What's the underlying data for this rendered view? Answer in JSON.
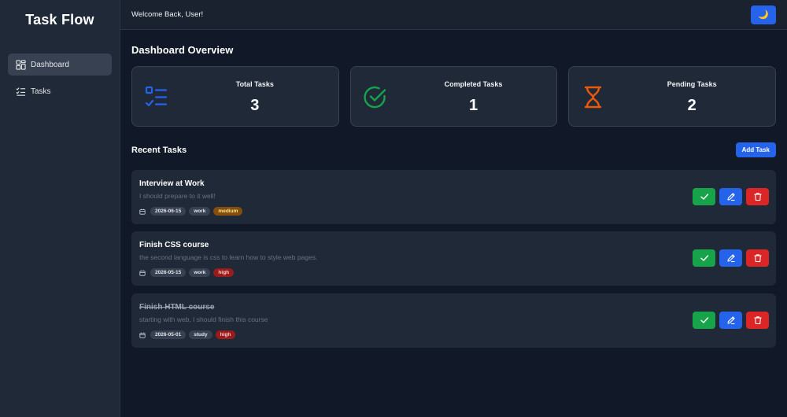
{
  "app": {
    "title": "Task Flow"
  },
  "sidebar": {
    "items": [
      {
        "label": "Dashboard",
        "icon": "dashboard-grid-icon",
        "active": true
      },
      {
        "label": "Tasks",
        "icon": "task-list-icon",
        "active": false
      }
    ]
  },
  "header": {
    "welcome": "Welcome Back, User!",
    "theme_icon": "moon-icon"
  },
  "dashboard": {
    "title": "Dashboard Overview",
    "stats": [
      {
        "label": "Total Tasks",
        "value": "3",
        "icon": "list-check-icon",
        "color": "#2563eb"
      },
      {
        "label": "Completed Tasks",
        "value": "1",
        "icon": "circle-check-icon",
        "color": "#16a34a"
      },
      {
        "label": "Pending Tasks",
        "value": "2",
        "icon": "hourglass-icon",
        "color": "#ea580c"
      }
    ]
  },
  "recent": {
    "title": "Recent Tasks",
    "add_label": "Add Task",
    "tasks": [
      {
        "title": "Interview at Work",
        "description": "I should prepare to it well!",
        "date": "2026-06-15",
        "category": "work",
        "priority": "medium",
        "completed": false
      },
      {
        "title": "Finish CSS course",
        "description": "the second language is css to learn how to style web pages.",
        "date": "2026-05-15",
        "category": "work",
        "priority": "high",
        "completed": false
      },
      {
        "title": "Finish HTML course",
        "description": "starting with web, I should finish this course",
        "date": "2026-05-01",
        "category": "study",
        "priority": "high",
        "completed": true
      }
    ]
  },
  "colors": {
    "accent": "#2563eb",
    "success": "#16a34a",
    "danger": "#dc2626",
    "warning": "#ea580c",
    "background": "#111827",
    "panel": "#1f2937"
  }
}
